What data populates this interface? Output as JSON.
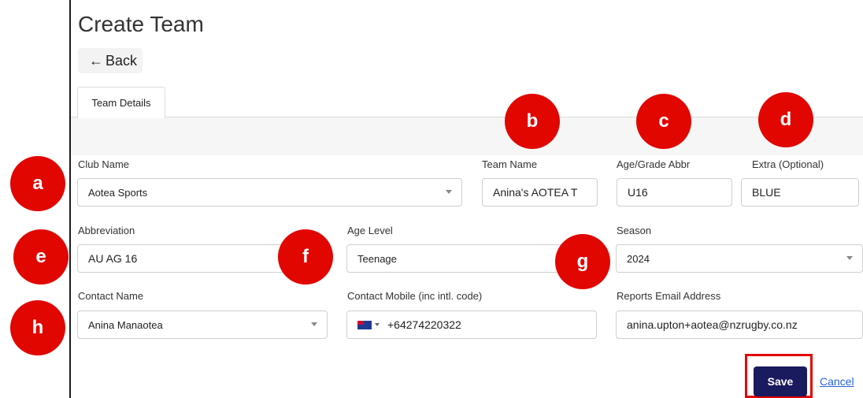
{
  "page": {
    "title": "Create Team",
    "back_label": "Back"
  },
  "tabs": [
    {
      "label": "Team Details"
    }
  ],
  "form": {
    "club_name": {
      "label": "Club Name",
      "value": "Aotea Sports"
    },
    "team_name": {
      "label": "Team Name",
      "value": "Anina's AOTEA T"
    },
    "age_grade_abbr": {
      "label": "Age/Grade Abbr",
      "value": "U16"
    },
    "extra": {
      "label": "Extra (Optional)",
      "value": "BLUE"
    },
    "abbreviation": {
      "label": "Abbreviation",
      "value": "AU AG 16"
    },
    "age_level": {
      "label": "Age Level",
      "value": "Teenage"
    },
    "season": {
      "label": "Season",
      "value": "2024"
    },
    "contact_name": {
      "label": "Contact Name",
      "value": "Anina Manaotea"
    },
    "contact_mobile": {
      "label": "Contact Mobile (inc intl. code)",
      "value": "+64274220322"
    },
    "reports_email": {
      "label": "Reports Email Address",
      "value": "anina.upton+aotea@nzrugby.co.nz"
    }
  },
  "actions": {
    "save_label": "Save",
    "cancel_label": "Cancel"
  },
  "annotations": [
    "a",
    "b",
    "c",
    "d",
    "e",
    "f",
    "g",
    "h"
  ],
  "colors": {
    "annotation": "#e10600",
    "save_button": "#1a1a5e",
    "link": "#2962d9"
  }
}
